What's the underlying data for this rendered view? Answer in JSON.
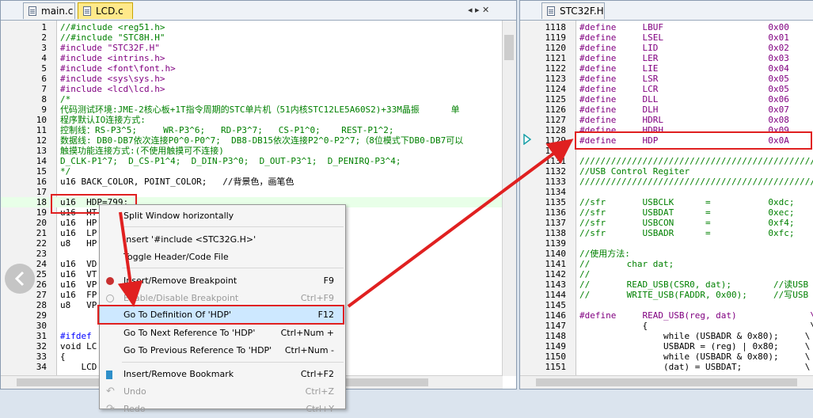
{
  "left_tabs": [
    {
      "label": "main.c"
    },
    {
      "label": "LCD.c"
    }
  ],
  "right_tabs": [
    {
      "label": "STC32F.H"
    }
  ],
  "tab_controls": "◂ ▸ ✕",
  "left_lines": [
    {
      "n": "1",
      "t": "//#include <reg51.h>",
      "cls": "c"
    },
    {
      "n": "2",
      "t": "//#include \"STC8H.H\"",
      "cls": "c"
    },
    {
      "n": "3",
      "t": "#include \"STC32F.H\"",
      "cls": "r"
    },
    {
      "n": "4",
      "t": "#include <intrins.h>",
      "cls": "r"
    },
    {
      "n": "5",
      "t": "#include <font\\font.h>",
      "cls": "r"
    },
    {
      "n": "6",
      "t": "#include <sys\\sys.h>",
      "cls": "r"
    },
    {
      "n": "7",
      "t": "#include <lcd\\lcd.h>",
      "cls": "r"
    },
    {
      "n": "8",
      "t": "/*",
      "cls": "c"
    },
    {
      "n": "9",
      "t": "代码测试环境:JME-2核心板+1T指令周期的STC单片机（51内核STC12LE5A60S2)+33M晶振      单",
      "cls": "c"
    },
    {
      "n": "10",
      "t": "程序默认IO连接方式:",
      "cls": "c"
    },
    {
      "n": "11",
      "t": "控制线：RS-P3^5;     WR-P3^6;   RD-P3^7;   CS-P1^0;    REST-P1^2;",
      "cls": "c"
    },
    {
      "n": "12",
      "t": "数据线: DB0-DB7依次连接P0^0-P0^7;  DB8-DB15依次连接P2^0-P2^7;（8位模式下DB0-DB7可以",
      "cls": "c"
    },
    {
      "n": "13",
      "t": "触摸功能连接方式:(不使用触摸可不连接)",
      "cls": "c"
    },
    {
      "n": "14",
      "t": "D_CLK-P1^7;  D_CS-P1^4;  D_DIN-P3^0;  D_OUT-P3^1;  D_PENIRQ-P3^4;",
      "cls": "c"
    },
    {
      "n": "15",
      "t": "*/",
      "cls": "c"
    },
    {
      "n": "16",
      "t": "u16 BACK_COLOR, POINT_COLOR;   //背景色，画笔色",
      "cls": "t"
    },
    {
      "n": "17",
      "t": "",
      "cls": "t"
    },
    {
      "n": "18",
      "t": "u16  HDP=799;",
      "cls": "t"
    },
    {
      "n": "19",
      "t": "u16  HT",
      "cls": "t"
    },
    {
      "n": "20",
      "t": "u16  HP",
      "cls": "t"
    },
    {
      "n": "21",
      "t": "u16  LP",
      "cls": "t"
    },
    {
      "n": "22",
      "t": "u8   HP",
      "cls": "t"
    },
    {
      "n": "23",
      "t": "",
      "cls": "t"
    },
    {
      "n": "24",
      "t": "u16  VD",
      "cls": "t"
    },
    {
      "n": "25",
      "t": "u16  VT",
      "cls": "t"
    },
    {
      "n": "26",
      "t": "u16  VP",
      "cls": "t"
    },
    {
      "n": "27",
      "t": "u16  FP",
      "cls": "t"
    },
    {
      "n": "28",
      "t": "u8   VP",
      "cls": "t"
    },
    {
      "n": "29",
      "t": "",
      "cls": "t"
    },
    {
      "n": "30",
      "t": "",
      "cls": "t"
    },
    {
      "n": "31",
      "t": "#ifdef                                             函数",
      "cls": "k"
    },
    {
      "n": "32",
      "t": "void LC",
      "cls": "t"
    },
    {
      "n": "33",
      "t": "{",
      "cls": "t"
    },
    {
      "n": "34",
      "t": "    LCD",
      "cls": "t"
    }
  ],
  "right_lines": [
    {
      "n": "1118",
      "t": "#define     LBUF                    0x00",
      "cls": "r"
    },
    {
      "n": "1119",
      "t": "#define     LSEL                    0x01",
      "cls": "r"
    },
    {
      "n": "1120",
      "t": "#define     LID                     0x02",
      "cls": "r"
    },
    {
      "n": "1121",
      "t": "#define     LER                     0x03",
      "cls": "r"
    },
    {
      "n": "1122",
      "t": "#define     LIE                     0x04",
      "cls": "r"
    },
    {
      "n": "1123",
      "t": "#define     LSR                     0x05",
      "cls": "r"
    },
    {
      "n": "1124",
      "t": "#define     LCR                     0x05",
      "cls": "r"
    },
    {
      "n": "1125",
      "t": "#define     DLL                     0x06",
      "cls": "r"
    },
    {
      "n": "1126",
      "t": "#define     DLH                     0x07",
      "cls": "r"
    },
    {
      "n": "1127",
      "t": "#define     HDRL                    0x08",
      "cls": "r"
    },
    {
      "n": "1128",
      "t": "#define     HDRH                    0x09",
      "cls": "r"
    },
    {
      "n": "1129",
      "t": "#define     HDP                     0x0A",
      "cls": "r"
    },
    {
      "n": "1130",
      "t": "",
      "cls": "t"
    },
    {
      "n": "1131",
      "t": "/////////////////////////////////////////////",
      "cls": "c"
    },
    {
      "n": "1132",
      "t": "//USB Control Regiter",
      "cls": "c"
    },
    {
      "n": "1133",
      "t": "/////////////////////////////////////////////",
      "cls": "c"
    },
    {
      "n": "1134",
      "t": "",
      "cls": "t"
    },
    {
      "n": "1135",
      "t": "//sfr       USBCLK      =           0xdc;",
      "cls": "c"
    },
    {
      "n": "1136",
      "t": "//sfr       USBDAT      =           0xec;",
      "cls": "c"
    },
    {
      "n": "1137",
      "t": "//sfr       USBCON      =           0xf4;",
      "cls": "c"
    },
    {
      "n": "1138",
      "t": "//sfr       USBADR      =           0xfc;",
      "cls": "c"
    },
    {
      "n": "1139",
      "t": "",
      "cls": "t"
    },
    {
      "n": "1140",
      "t": "//使用方法:",
      "cls": "c"
    },
    {
      "n": "1141",
      "t": "//       char dat;",
      "cls": "c"
    },
    {
      "n": "1142",
      "t": "//",
      "cls": "c"
    },
    {
      "n": "1143",
      "t": "//       READ_USB(CSR0, dat);        //读USB",
      "cls": "c"
    },
    {
      "n": "1144",
      "t": "//       WRITE_USB(FADDR, 0x00);     //写USB",
      "cls": "c"
    },
    {
      "n": "1145",
      "t": "",
      "cls": "t"
    },
    {
      "n": "1146",
      "t": "#define     READ_USB(reg, dat)              \\",
      "cls": "r"
    },
    {
      "n": "1147",
      "t": "            {                               \\",
      "cls": "t"
    },
    {
      "n": "1148",
      "t": "                while (USBADR & 0x80);     \\",
      "cls": "t"
    },
    {
      "n": "1149",
      "t": "                USBADR = (reg) | 0x80;     \\",
      "cls": "t"
    },
    {
      "n": "1150",
      "t": "                while (USBADR & 0x80);     \\",
      "cls": "t"
    },
    {
      "n": "1151",
      "t": "                (dat) = USBDAT;            \\",
      "cls": "t"
    }
  ],
  "menu": {
    "items": [
      {
        "label": "Split Window horizontally",
        "shortcut": "",
        "disabled": false,
        "icon": ""
      },
      {
        "label": "Insert '#include <STC32G.H>'",
        "shortcut": "",
        "disabled": false,
        "icon": ""
      },
      {
        "label": "Toggle Header/Code File",
        "shortcut": "",
        "disabled": false,
        "icon": ""
      },
      {
        "label": "Insert/Remove Breakpoint",
        "shortcut": "F9",
        "disabled": false,
        "icon": "breakpoint-icon"
      },
      {
        "label": "Enable/Disable Breakpoint",
        "shortcut": "Ctrl+F9",
        "disabled": true,
        "icon": "breakpoint-disable-icon"
      },
      {
        "label": "Go To Definition Of 'HDP'",
        "shortcut": "F12",
        "disabled": false,
        "icon": ""
      },
      {
        "label": "Go To Next Reference To 'HDP'",
        "shortcut": "Ctrl+Num +",
        "disabled": false,
        "icon": ""
      },
      {
        "label": "Go To Previous Reference To 'HDP'",
        "shortcut": "Ctrl+Num -",
        "disabled": false,
        "icon": ""
      },
      {
        "label": "Insert/Remove Bookmark",
        "shortcut": "Ctrl+F2",
        "disabled": false,
        "icon": "bookmark-icon"
      },
      {
        "label": "Undo",
        "shortcut": "Ctrl+Z",
        "disabled": true,
        "icon": "undo-icon"
      },
      {
        "label": "Redo",
        "shortcut": "Ctrl+Y",
        "disabled": true,
        "icon": "redo-icon"
      }
    ]
  },
  "colors": {
    "highlight_box": "#e02020",
    "active_tab": "#ffe98a",
    "menu_selected": "#cde8ff"
  }
}
